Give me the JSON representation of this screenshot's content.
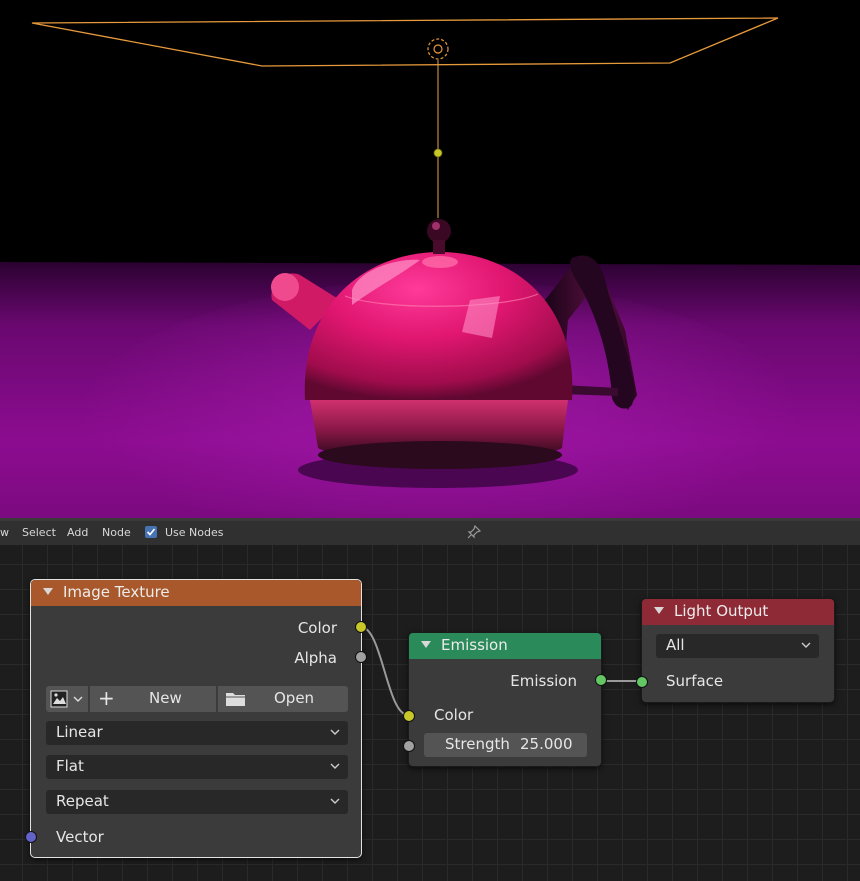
{
  "viewport": {
    "background": "#000000",
    "floor_color": "#8a0a8c",
    "teapot_color": "#e0156c",
    "light_color": "#e79a3c"
  },
  "header": {
    "menu": [
      "w",
      "Select",
      "Add",
      "Node"
    ],
    "use_nodes_label": "Use Nodes",
    "use_nodes_checked": true
  },
  "nodes": {
    "image_texture": {
      "title": "Image Texture",
      "header_color": "#a8582b",
      "outputs": [
        "Color",
        "Alpha"
      ],
      "new_label": "New",
      "open_label": "Open",
      "interpolation": "Linear",
      "projection": "Flat",
      "extension": "Repeat",
      "inputs": [
        "Vector"
      ]
    },
    "emission": {
      "title": "Emission",
      "header_color": "#2b8a5a",
      "output": "Emission",
      "color_input": "Color",
      "strength_label": "Strength",
      "strength_value": "25.000"
    },
    "light_output": {
      "title": "Light Output",
      "header_color": "#8e2a36",
      "target": "All",
      "surface_input": "Surface"
    }
  }
}
